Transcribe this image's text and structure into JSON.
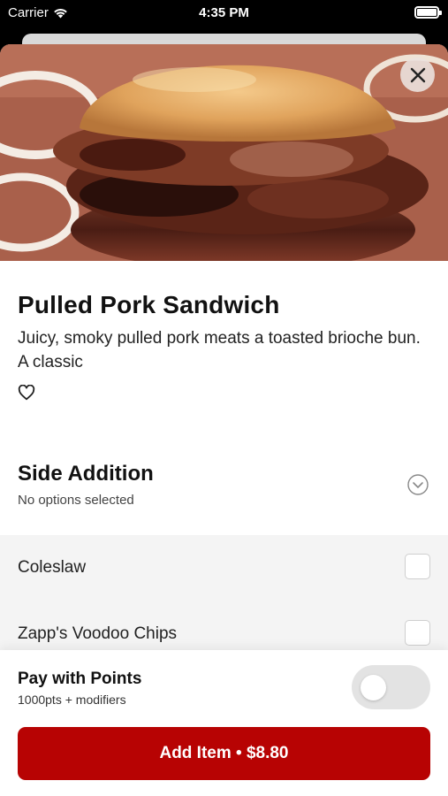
{
  "status_bar": {
    "carrier": "Carrier",
    "time": "4:35 PM",
    "wifi_icon": "wifi-icon",
    "battery_icon": "battery-full-icon"
  },
  "item": {
    "title": "Pulled Pork Sandwich",
    "description": "Juicy, smoky pulled pork meats a toasted brioche bun. A classic",
    "favorite_icon": "heart-outline-icon",
    "close_icon": "close-icon"
  },
  "side_addition": {
    "title": "Side Addition",
    "subtitle": "No options selected",
    "expand_icon": "chevron-down-circle-icon",
    "options": [
      {
        "label": "Coleslaw",
        "checked": false
      },
      {
        "label": "Zapp's Voodoo Chips",
        "checked": false
      }
    ]
  },
  "footer": {
    "pay_title": "Pay with Points",
    "pay_subtitle": "1000pts + modifiers",
    "pay_toggle_on": false,
    "add_button_label": "Add Item • $8.80"
  },
  "colors": {
    "accent": "#b70303",
    "toggle_off": "#e3e3e3",
    "options_bg": "#f4f4f4"
  }
}
